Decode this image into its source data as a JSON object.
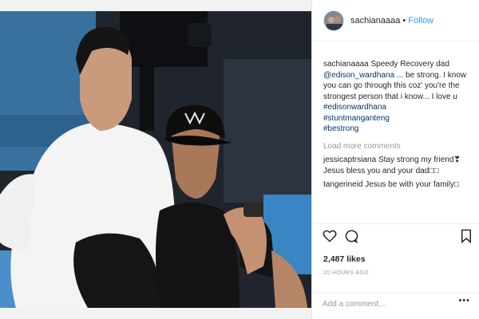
{
  "header": {
    "username": "sachianaaaa",
    "separator": "•",
    "follow_label": "Follow"
  },
  "caption": {
    "username": "sachianaaaa",
    "text_a": "Speedy Recovery dad",
    "mention": "@edison_wardhana",
    "text_b": " ... be strong. I know you can go through this coz' you're the strongest person that i know... I love u",
    "hashtags": [
      "#edisonwardhana",
      "#stuntmanganteng",
      "#bestrong"
    ]
  },
  "load_more_label": "Load more comments",
  "comments": [
    {
      "username": "jessicaptrsiana",
      "text": "Stay strong my friend❣ Jesus bless you and your dad□□"
    },
    {
      "username": "tangerineid",
      "text": "Jesus be with your family□"
    }
  ],
  "actions": {
    "like_icon": "heart-icon",
    "comment_icon": "speech-bubble-icon",
    "save_icon": "bookmark-icon"
  },
  "likes_text": "2,487 likes",
  "timestamp": "20 HOURS AGO",
  "add_comment": {
    "placeholder": "Add a comment...",
    "options_label": "•••"
  },
  "colors": {
    "link": "#3897f0",
    "hashtag": "#00376b",
    "muted": "#999999"
  }
}
